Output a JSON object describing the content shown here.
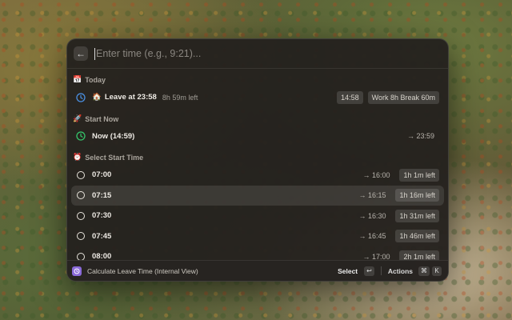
{
  "search": {
    "placeholder": "Enter time (e.g., 9:21)..."
  },
  "sections": {
    "today": {
      "icon": "📅",
      "title": "Today"
    },
    "start_now": {
      "icon": "🚀",
      "title": "Start Now"
    },
    "select_start": {
      "icon": "⏰",
      "title": "Select Start Time"
    }
  },
  "today_item": {
    "icon": "clock-blue",
    "emoji": "🏠",
    "title": "Leave at 23:58",
    "subtitle": "8h 59m left",
    "tag1": "14:58",
    "tag2": "Work 8h Break 60m"
  },
  "now_item": {
    "icon": "clock-green",
    "title": "Now (14:59)",
    "accessory": "→ 23:59"
  },
  "times": [
    {
      "title": "07:00",
      "leave": "→ 16:00",
      "left": "1h 1m left",
      "selected": false
    },
    {
      "title": "07:15",
      "leave": "→ 16:15",
      "left": "1h 16m left",
      "selected": true
    },
    {
      "title": "07:30",
      "leave": "→ 16:30",
      "left": "1h 31m left",
      "selected": false
    },
    {
      "title": "07:45",
      "leave": "→ 16:45",
      "left": "1h 46m left",
      "selected": false
    },
    {
      "title": "08:00",
      "leave": "→ 17:00",
      "left": "2h 1m left",
      "selected": false
    }
  ],
  "footer": {
    "command_title": "Calculate Leave Time (Internal View)",
    "primary_action": "Select",
    "enter_key": "↩",
    "actions_label": "Actions",
    "cmd_key": "⌘",
    "k_key": "K"
  },
  "colors": {
    "blue": "#4a90e2",
    "green": "#35c46a",
    "app_icon": "#8a6ad8"
  }
}
